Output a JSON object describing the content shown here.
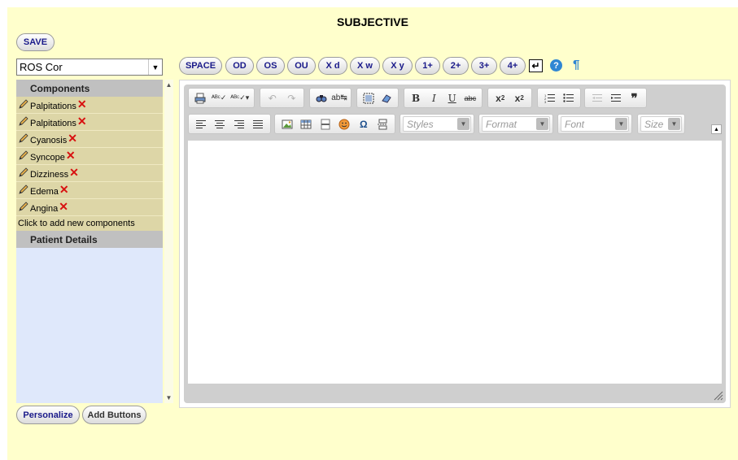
{
  "page": {
    "title": "SUBJECTIVE"
  },
  "actions": {
    "save": "SAVE"
  },
  "section_select": {
    "value": "ROS Cor"
  },
  "quick_buttons": [
    "SPACE",
    "OD",
    "OS",
    "OU",
    "X d",
    "X w",
    "X y",
    "1+",
    "2+",
    "3+",
    "4+"
  ],
  "misc_icons": {
    "enter": "enter-icon",
    "help": "help-icon",
    "pilcrow": "¶"
  },
  "components": {
    "header": "Components",
    "items": [
      "Palpitations",
      "Palpitations",
      "Cyanosis",
      "Syncope",
      "Dizziness",
      "Edema",
      "Angina"
    ],
    "add_new": "Click to add new components"
  },
  "patient_details": {
    "header": "Patient Details"
  },
  "editor": {
    "combos": {
      "styles": "Styles",
      "format": "Format",
      "font": "Font",
      "size": "Size"
    }
  },
  "footer": {
    "personalize": "Personalize",
    "add_buttons": "Add Buttons"
  },
  "colors": {
    "panel_bg": "#ffffcc",
    "component_row": "#ddd6a7",
    "list_bg": "#dfe8fb",
    "header_gray": "#c0c0c0",
    "button_text": "#1a1a8a",
    "delete_red": "#d81010"
  }
}
